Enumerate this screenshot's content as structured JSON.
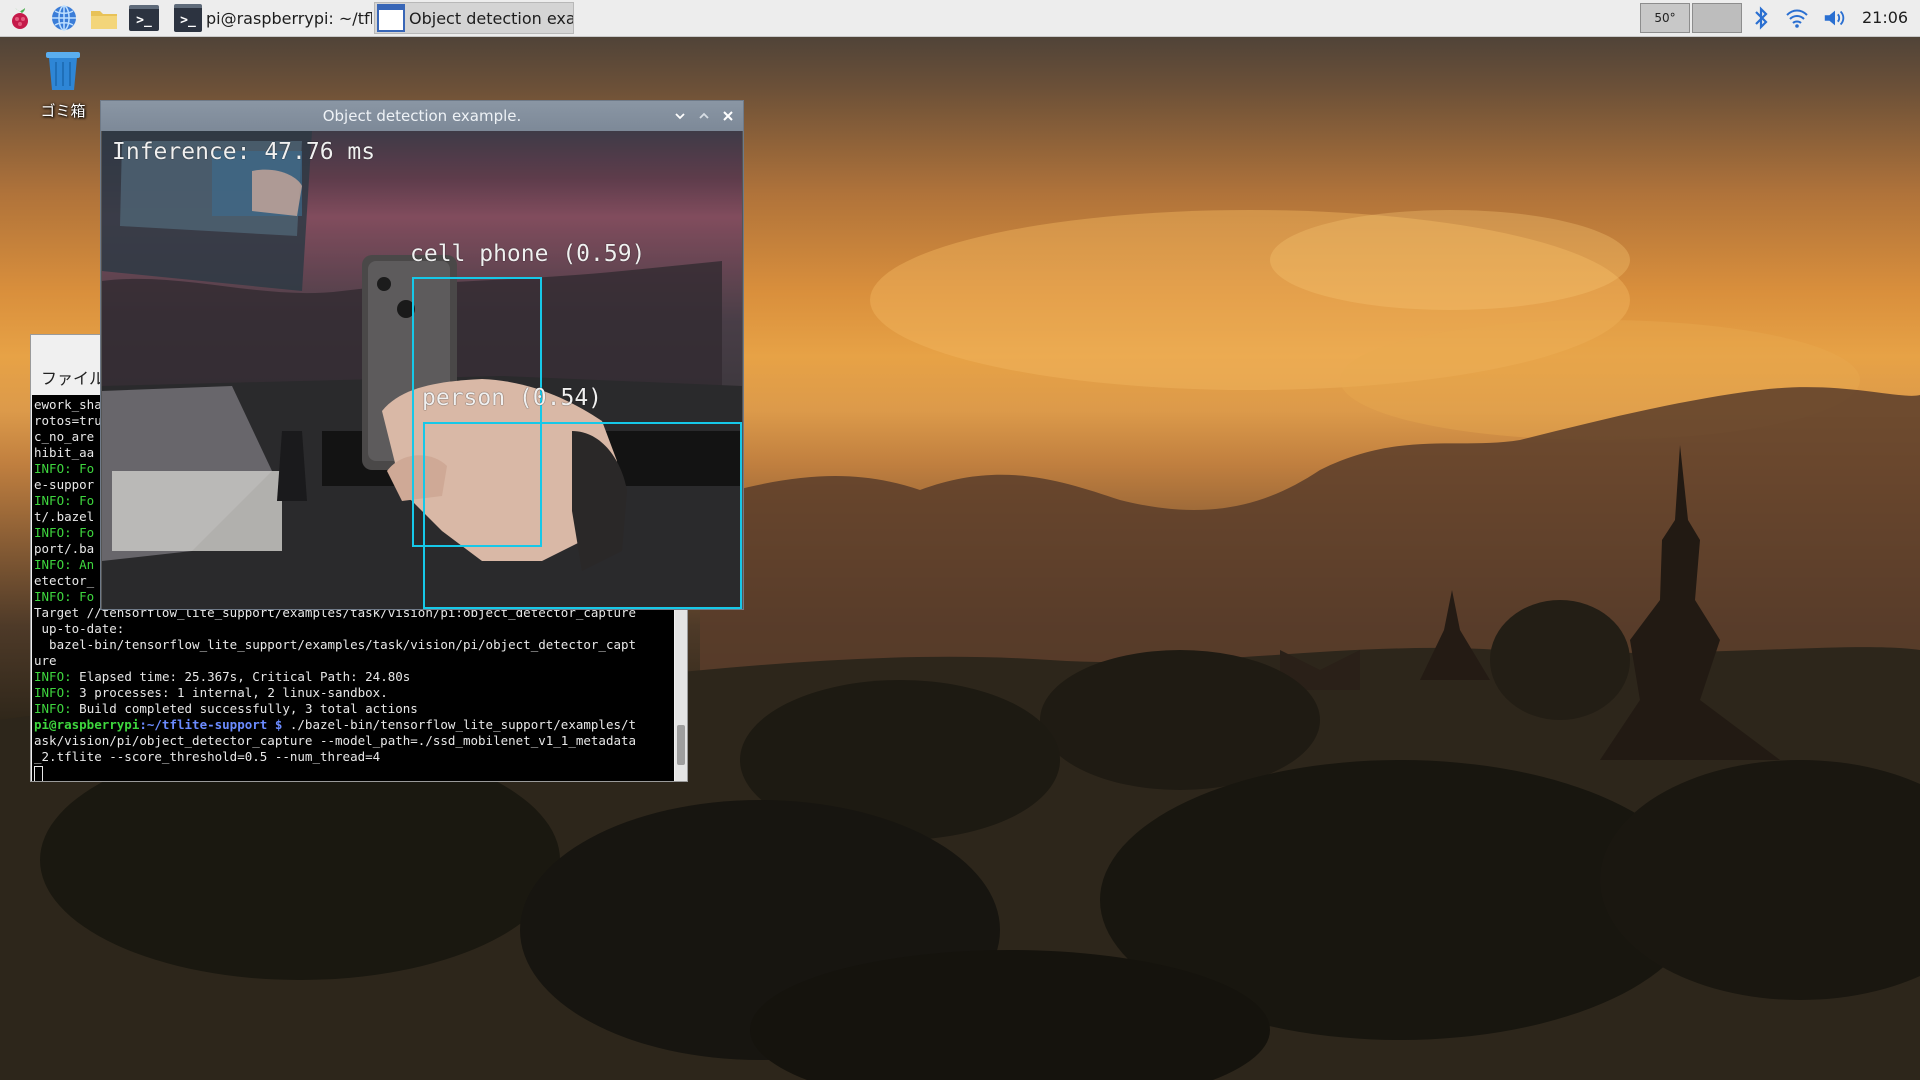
{
  "taskbar": {
    "tasks": [
      {
        "label": "pi@raspberrypi: ~/tfli...",
        "icon": "terminal-icon"
      },
      {
        "label": "Object detection exa...",
        "icon": "window-icon"
      }
    ],
    "cpu_temp": "50°",
    "clock": "21:06"
  },
  "desktop": {
    "trash_label": "ゴミ箱"
  },
  "terminal": {
    "menu_label": "ファイル",
    "lines": [
      "ework_sha",
      "rotos=tru",
      "c_no_are",
      "hibit_aa",
      "INFO: Fo",
      "e-suppor",
      "INFO: Fo",
      "t/.bazel",
      "INFO: Fo",
      "port/.ba",
      "INFO: An",
      "etector_",
      "INFO: Fo",
      "Target //tensorflow_lite_support/examples/task/vision/pi:object_detector_capture",
      " up-to-date:",
      "  bazel-bin/tensorflow_lite_support/examples/task/vision/pi/object_detector_capt",
      "ure"
    ],
    "info_lines": [
      "Elapsed time: 25.367s, Critical Path: 24.80s",
      "3 processes: 1 internal, 2 linux-sandbox.",
      "Build completed successfully, 3 total actions"
    ],
    "info_prefix": "INFO:",
    "prompt_user": "pi@raspberrypi",
    "prompt_path": ":~/tflite-support $",
    "command_1": " ./bazel-bin/tensorflow_lite_support/examples/t",
    "command_2": "ask/vision/pi/object_detector_capture --model_path=./ssd_mobilenet_v1_1_metadata",
    "command_3": "_2.tflite --score_threshold=0.5 --num_thread=4"
  },
  "detection_window": {
    "title": "Object detection example.",
    "inference_text": "Inference: 47.76 ms",
    "detections": [
      {
        "label": "cell phone (0.59)"
      },
      {
        "label": "person (0.54)"
      }
    ],
    "box_color": "#16c8e8"
  }
}
